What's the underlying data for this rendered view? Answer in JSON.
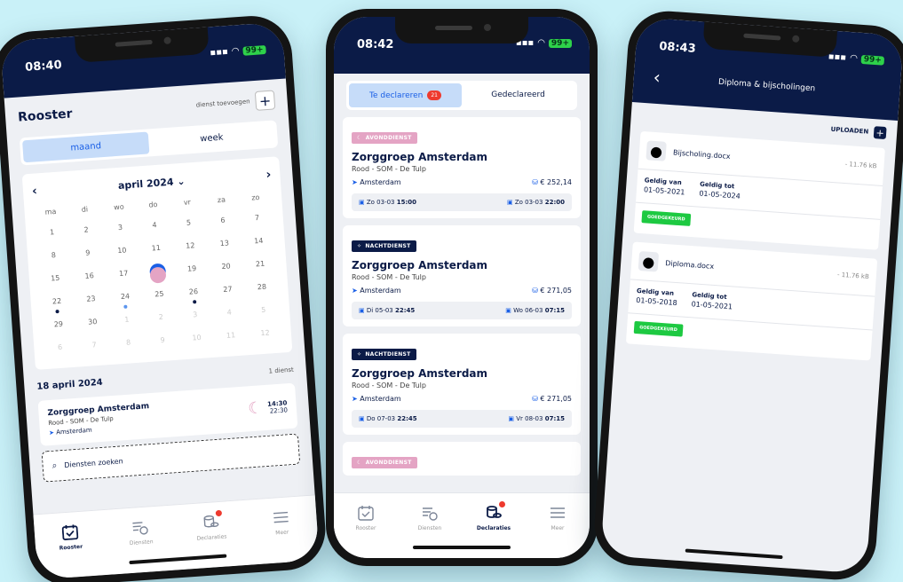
{
  "colors": {
    "navy": "#0b1b47",
    "accent": "#1a5fe6",
    "badge_avond": "#e4a4c4",
    "badge_goed": "#1dc941",
    "background": "#c9f1f8"
  },
  "status": {
    "battery": "99+"
  },
  "phone1": {
    "time": "08:40",
    "title": "Rooster",
    "add_label": "dienst toevoegen",
    "toggle": {
      "month": "maand",
      "week": "week"
    },
    "month_label": "april 2024",
    "weekdays": [
      "ma",
      "di",
      "wo",
      "do",
      "vr",
      "za",
      "zo"
    ],
    "days": [
      "1",
      "2",
      "3",
      "4",
      "5",
      "6",
      "7",
      "8",
      "9",
      "10",
      "11",
      "12",
      "13",
      "14",
      "15",
      "16",
      "17",
      "18",
      "19",
      "20",
      "21",
      "22",
      "23",
      "24",
      "25",
      "26",
      "27",
      "28",
      "29",
      "30",
      "1",
      "2",
      "3",
      "4",
      "5",
      "6",
      "7",
      "8",
      "9",
      "10",
      "11",
      "12"
    ],
    "selected_day": "18",
    "date_heading": "18 april 2024",
    "count": "1 dienst",
    "shift": {
      "org": "Zorggroep Amsterdam",
      "dept": "Rood - SOM - De Tulp",
      "city": "Amsterdam",
      "start": "14:30",
      "end": "22:30"
    },
    "search_placeholder": "Diensten zoeken"
  },
  "phone2": {
    "time": "08:42",
    "tab_left": "Te declareren",
    "tab_left_count": "21",
    "tab_right": "Gedeclareerd",
    "cards": [
      {
        "type": "AVONDDIENST",
        "org": "Zorggroep Amsterdam",
        "dept": "Rood - SOM - De Tulp",
        "city": "Amsterdam",
        "amount": "€ 252,14",
        "start_day": "Zo 03-03",
        "start_time": "15:00",
        "end_day": "Zo 03-03",
        "end_time": "22:00"
      },
      {
        "type": "NACHTDIENST",
        "org": "Zorggroep Amsterdam",
        "dept": "Rood - SOM - De Tulp",
        "city": "Amsterdam",
        "amount": "€ 271,05",
        "start_day": "Di 05-03",
        "start_time": "22:45",
        "end_day": "Wo 06-03",
        "end_time": "07:15"
      },
      {
        "type": "NACHTDIENST",
        "org": "Zorggroep Amsterdam",
        "dept": "Rood - SOM - De Tulp",
        "city": "Amsterdam",
        "amount": "€ 271,05",
        "start_day": "Do 07-03",
        "start_time": "22:45",
        "end_day": "Vr 08-03",
        "end_time": "07:15"
      },
      {
        "type": "AVONDDIENST"
      }
    ]
  },
  "phone3": {
    "time": "08:43",
    "title": "Diploma & bijscholingen",
    "upload": "UPLOADEN",
    "docs": [
      {
        "name": "Bijscholing.docx",
        "size": "- 11.76 kB",
        "from_label": "Geldig van",
        "from": "01-05-2021",
        "to_label": "Geldig tot",
        "to": "01-05-2024",
        "status": "GOEDGEKEURD"
      },
      {
        "name": "Diploma.docx",
        "size": "- 11.76 kB",
        "from_label": "Geldig van",
        "from": "01-05-2018",
        "to_label": "Geldig tot",
        "to": "01-05-2021",
        "status": "GOEDGEKEURD"
      }
    ]
  },
  "tabbar": {
    "rooster": "Rooster",
    "diensten": "Diensten",
    "declaraties": "Declaraties",
    "meer": "Meer"
  }
}
